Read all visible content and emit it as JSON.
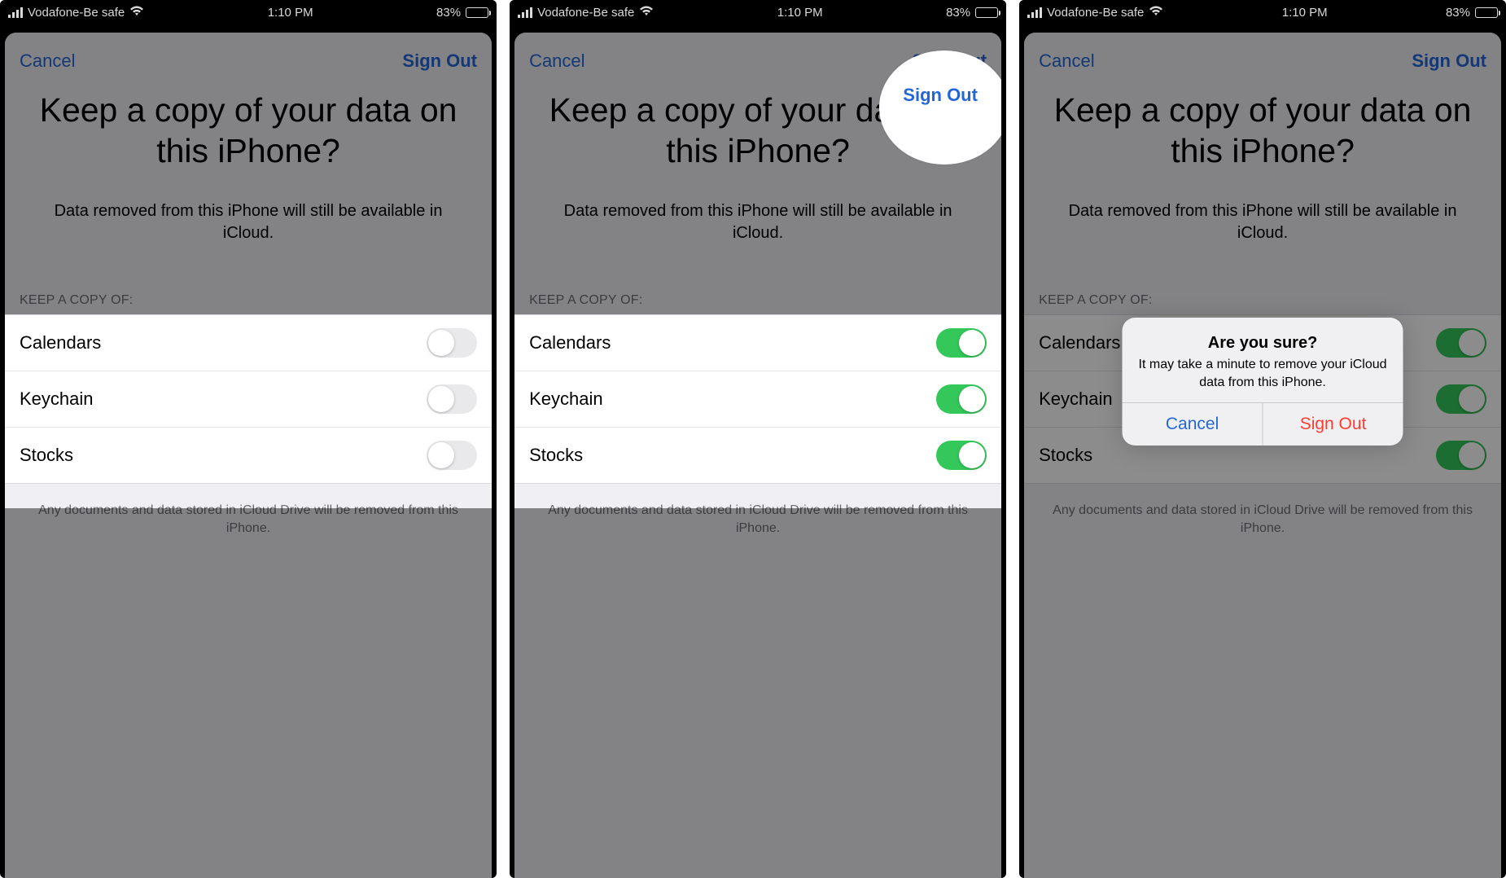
{
  "statusBar": {
    "carrier": "Vodafone-Be safe",
    "time": "1:10 PM",
    "batteryPct": "83%",
    "batteryFillPct": 83
  },
  "nav": {
    "cancel": "Cancel",
    "signOut": "Sign Out"
  },
  "title": "Keep a copy of your data on this iPhone?",
  "subtitle": "Data removed from this iPhone will still be available in iCloud.",
  "sectionHeader": "KEEP A COPY OF:",
  "items": [
    {
      "label": "Calendars"
    },
    {
      "label": "Keychain"
    },
    {
      "label": "Stocks"
    }
  ],
  "footer": "Any documents and data stored in iCloud Drive will be removed from this iPhone.",
  "alert": {
    "title": "Are you sure?",
    "message": "It may take a minute to remove your iCloud data from this iPhone.",
    "cancel": "Cancel",
    "confirm": "Sign Out"
  }
}
